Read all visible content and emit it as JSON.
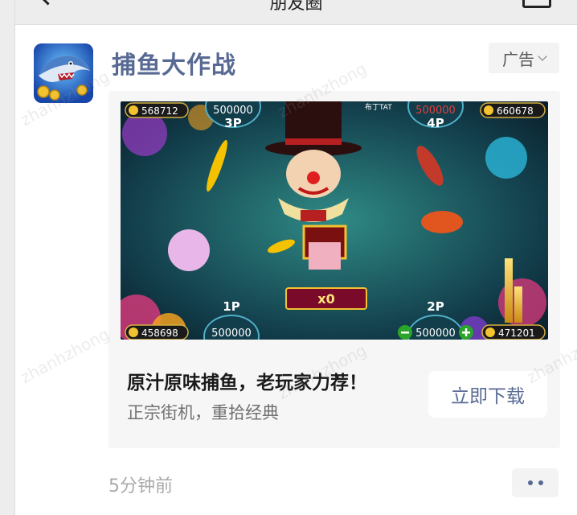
{
  "nav": {
    "title": "朋友圈"
  },
  "post": {
    "app_name": "捕鱼大作战",
    "ad_label": "广告",
    "banner": {
      "p3_score": "500000",
      "p3_label": "3P",
      "p4_score": "500000",
      "p4_label": "4P",
      "p1_score": "500000",
      "p1_label": "1P",
      "p2_score": "500000",
      "p2_label": "2P",
      "coins_top_left": "568712",
      "coins_top_right": "660678",
      "coins_bottom_left": "458698",
      "coins_bottom_right": "471201",
      "multiplier": "x0",
      "player_tag": "布丁TAT"
    },
    "headline": "原汁原味捕鱼，老玩家力荐！",
    "subline": "正宗街机，重拾经典",
    "download_label": "立即下载",
    "time": "5分钟前"
  },
  "watermark": "zhanhzhong",
  "colors": {
    "link": "#586a94",
    "card_bg": "#f6f6f6",
    "nav_bg": "#ededed"
  }
}
